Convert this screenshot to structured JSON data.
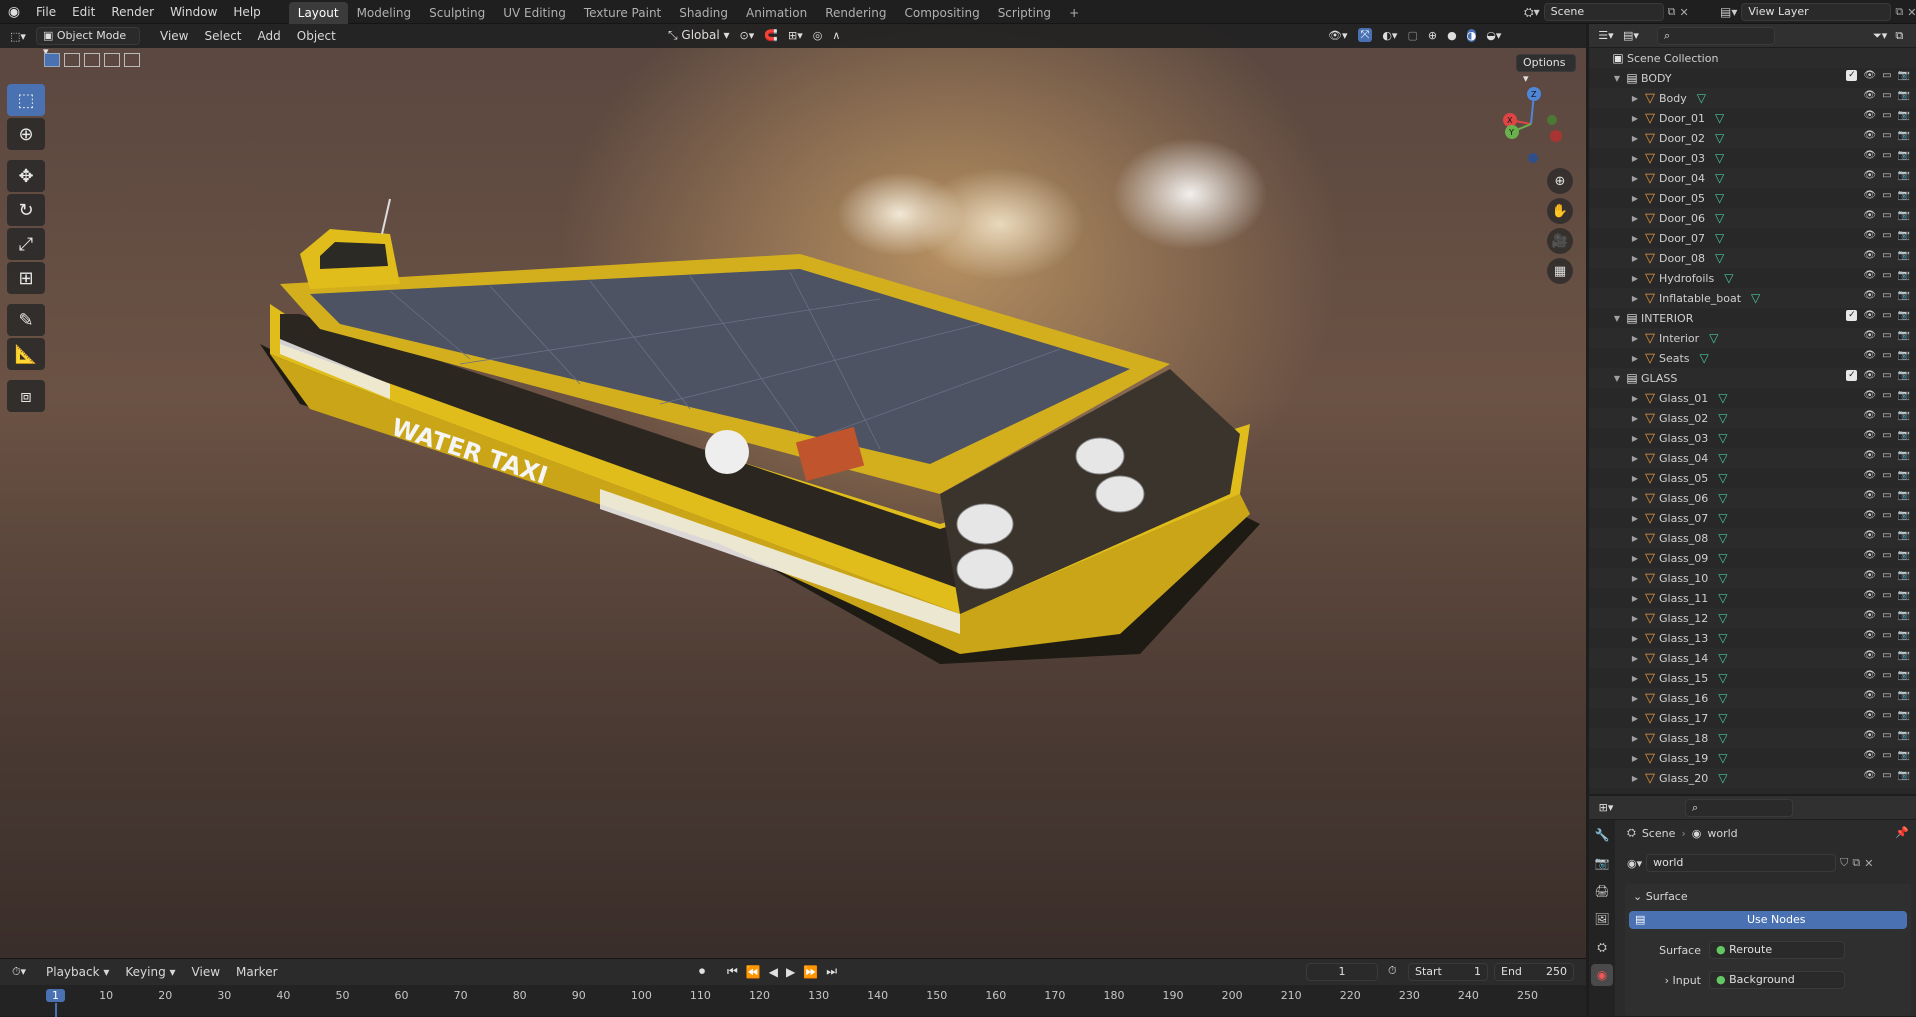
{
  "topbar": {
    "menus": [
      "File",
      "Edit",
      "Render",
      "Window",
      "Help"
    ],
    "workspaces": [
      "Layout",
      "Modeling",
      "Sculpting",
      "UV Editing",
      "Texture Paint",
      "Shading",
      "Animation",
      "Rendering",
      "Compositing",
      "Scripting"
    ],
    "active_workspace": "Layout",
    "add_tab": "+",
    "scene": "Scene",
    "view_layer": "View Layer"
  },
  "viewport_header": {
    "mode": "Object Mode",
    "menus": [
      "View",
      "Select",
      "Add",
      "Object"
    ],
    "orientation": "Global",
    "options": "Options"
  },
  "gizmo": {
    "z": "Z",
    "x": "X",
    "y": "Y"
  },
  "boat_text": {
    "hull": "WATER TAXI"
  },
  "outliner": {
    "search_placeholder": "",
    "scene_collection": "Scene Collection",
    "collections": [
      {
        "name": "BODY",
        "items": [
          "Body",
          "Door_01",
          "Door_02",
          "Door_03",
          "Door_04",
          "Door_05",
          "Door_06",
          "Door_07",
          "Door_08",
          "Hydrofoils",
          "Inflatable_boat"
        ]
      },
      {
        "name": "INTERIOR",
        "items": [
          "Interior",
          "Seats"
        ]
      },
      {
        "name": "GLASS",
        "items": [
          "Glass_01",
          "Glass_02",
          "Glass_03",
          "Glass_04",
          "Glass_05",
          "Glass_06",
          "Glass_07",
          "Glass_08",
          "Glass_09",
          "Glass_10",
          "Glass_11",
          "Glass_12",
          "Glass_13",
          "Glass_14",
          "Glass_15",
          "Glass_16",
          "Glass_17",
          "Glass_18",
          "Glass_19",
          "Glass_20"
        ]
      }
    ]
  },
  "properties": {
    "breadcrumb_scene": "Scene",
    "breadcrumb_world": "world",
    "world_name": "world",
    "section": "Surface",
    "use_nodes": "Use Nodes",
    "surface_label": "Surface",
    "surface_value": "Reroute",
    "input_label": "Input",
    "input_value": "Background"
  },
  "timeline": {
    "menus": [
      "Playback",
      "Keying",
      "View",
      "Marker"
    ],
    "current_frame": "1",
    "start_label": "Start",
    "start": "1",
    "end_label": "End",
    "end": "250",
    "ticks": [
      "1",
      "10",
      "20",
      "30",
      "40",
      "50",
      "60",
      "70",
      "80",
      "90",
      "100",
      "110",
      "120",
      "130",
      "140",
      "150",
      "160",
      "170",
      "180",
      "190",
      "200",
      "210",
      "220",
      "230",
      "240",
      "250"
    ]
  },
  "colors": {
    "accent": "#4a72b3",
    "boat_yellow": "#e8c11c",
    "object_orange": "#e8963c",
    "mesh_green": "#49c6a0"
  }
}
